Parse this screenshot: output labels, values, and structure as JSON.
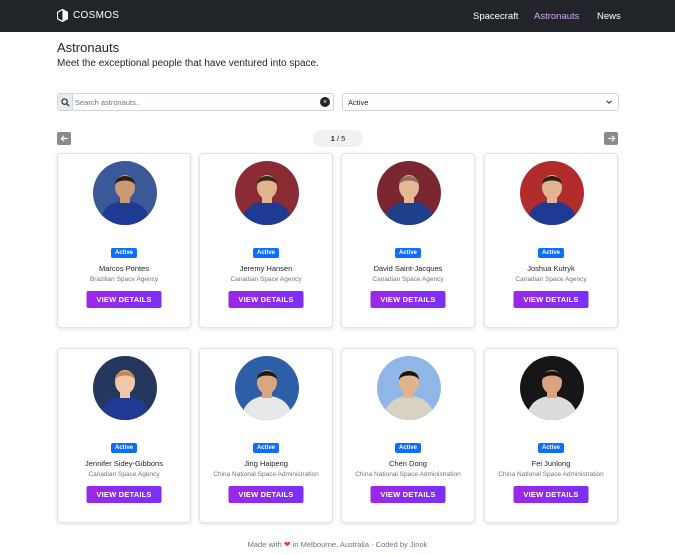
{
  "navbar": {
    "brand": "COSMOS",
    "links": [
      {
        "label": "Spacecraft",
        "active": false
      },
      {
        "label": "Astronauts",
        "active": true
      },
      {
        "label": "News",
        "active": false
      }
    ]
  },
  "header": {
    "title": "Astronauts",
    "subtitle": "Meet the exceptional people that have ventured into space."
  },
  "filters": {
    "search_placeholder": "Search astronauts..",
    "search_value": "",
    "clear_symbol": "×",
    "status_selected": "Active"
  },
  "pagination": {
    "current": "1",
    "separator": " / ",
    "total": "5"
  },
  "astronauts": [
    {
      "name": "Marcos Pontes",
      "agency": "Brazilian Space Agency",
      "status": "Active",
      "button": "VIEW DETAILS",
      "bg": "#3b5998",
      "skin": "#c99a74",
      "hair": "#2b1d14",
      "suit": "#1f3a93"
    },
    {
      "name": "Jeremy Hansen",
      "agency": "Canadian Space Agency",
      "status": "Active",
      "button": "VIEW DETAILS",
      "bg": "#8b2b34",
      "skin": "#e0b48e",
      "hair": "#3b2a1c",
      "suit": "#1f3a93"
    },
    {
      "name": "David Saint-Jacques",
      "agency": "Canadian Space Agency",
      "status": "Active",
      "button": "VIEW DETAILS",
      "bg": "#7a2630",
      "skin": "#e4b896",
      "hair": "#8a6f5a",
      "suit": "#1e3f8a"
    },
    {
      "name": "Joshua Kutryk",
      "agency": "Canadian Space Agency",
      "status": "Active",
      "button": "VIEW DETAILS",
      "bg": "#b32c2c",
      "skin": "#e2b48f",
      "hair": "#2e2218",
      "suit": "#1f3a93"
    },
    {
      "name": "Jennifer Sidey-Gibbons",
      "agency": "Canadian Space Agency",
      "status": "Active",
      "button": "VIEW DETAILS",
      "bg": "#23385c",
      "skin": "#f0c8a8",
      "hair": "#c9874f",
      "suit": "#1f3a93"
    },
    {
      "name": "Jing Haipeng",
      "agency": "China National Space Administration",
      "status": "Active",
      "button": "VIEW DETAILS",
      "bg": "#2d5ea8",
      "skin": "#d9a57f",
      "hair": "#1a1a1a",
      "suit": "#e8e8e8"
    },
    {
      "name": "Chen Dong",
      "agency": "China National Space Administration",
      "status": "Active",
      "button": "VIEW DETAILS",
      "bg": "#8fb6e6",
      "skin": "#e2b48c",
      "hair": "#151515",
      "suit": "#d8d2c4"
    },
    {
      "name": "Fei Junlong",
      "agency": "China National Space Administration",
      "status": "Active",
      "button": "VIEW DETAILS",
      "bg": "#161616",
      "skin": "#d9a47c",
      "hair": "#141414",
      "suit": "#dcdcdc"
    }
  ],
  "footer": {
    "prefix": "Made with",
    "heart": "❤",
    "suffix": "in Melbourne, Australia · Coded by Jinok"
  },
  "colors": {
    "navbar_bg": "#212529",
    "nav_active": "#d1a6f5",
    "badge": "#0d6efd",
    "button_gradient_start": "#9b28e6",
    "button_gradient_end": "#7b2ff7"
  }
}
